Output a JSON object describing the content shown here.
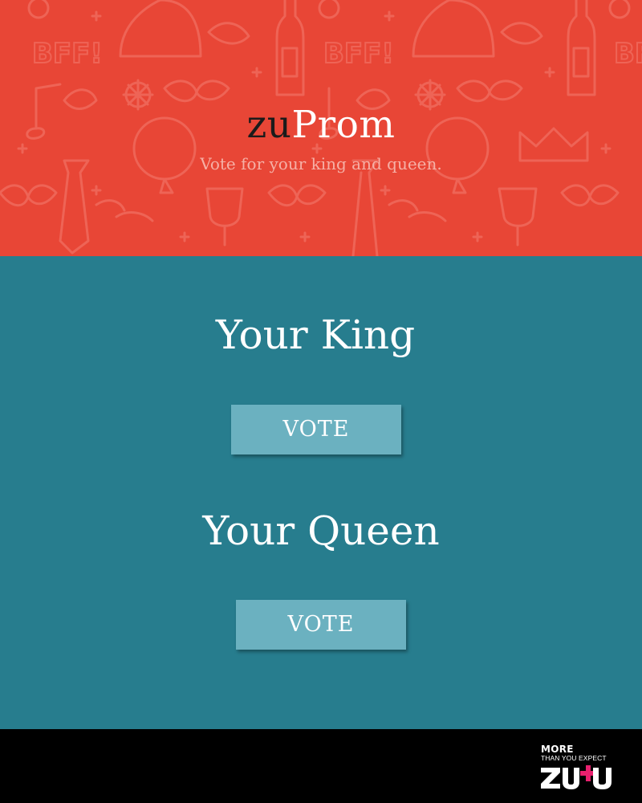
{
  "header": {
    "brand_prefix": "zu",
    "brand_main": "Prom",
    "tagline": "Vote for your king and queen.",
    "background_color": "#e84636",
    "pattern_icons": [
      "bff-text-icon",
      "bottle-icon",
      "cake-icon",
      "bow-tie-icon",
      "crown-icon",
      "wine-glass-icon",
      "balloon-icon",
      "leaf-icon",
      "snowflake-icon",
      "music-note-icon",
      "sparkle-icon",
      "tie-icon"
    ],
    "pattern_text": "BFF!"
  },
  "main": {
    "background_color": "#277d8e",
    "king": {
      "heading": "Your King",
      "button_label": "VOTE"
    },
    "queen": {
      "heading": "Your Queen",
      "button_label": "VOTE"
    },
    "button_color": "#6bb1c0"
  },
  "footer": {
    "logo_top": "MORE",
    "logo_sub": "THAN YOU EXPECT",
    "logo_mark": "ZU+U",
    "logo_plus_color": "#e8206e"
  }
}
